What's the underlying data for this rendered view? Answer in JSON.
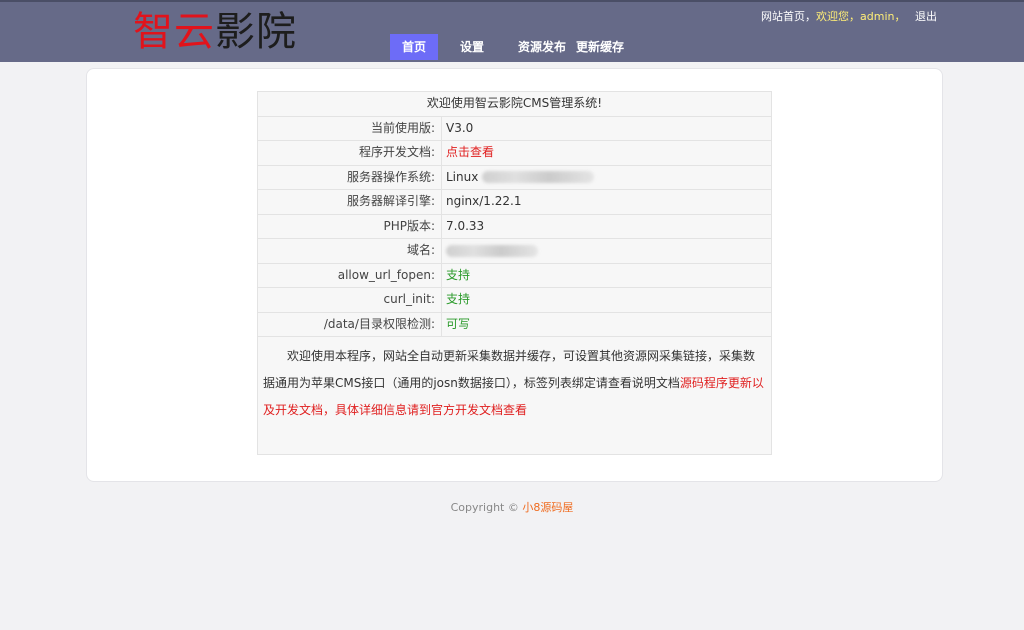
{
  "header": {
    "logo_part1": "智云",
    "logo_part2": "影院",
    "nav": [
      {
        "label": "首页"
      },
      {
        "label": "设置"
      },
      {
        "label": "资源发布"
      },
      {
        "label": "更新缓存"
      }
    ],
    "links": {
      "site_home": "网站首页",
      "separator1": "，",
      "welcome": "欢迎您，admin，",
      "logout": "退出"
    }
  },
  "info": {
    "title": "欢迎使用智云影院CMS管理系统!",
    "rows": [
      {
        "key": "当前使用版:",
        "value": "V3.0"
      },
      {
        "key": "程序开发文档:",
        "value": "点击查看"
      },
      {
        "key": "服务器操作系统:",
        "value": "Linux"
      },
      {
        "key": "服务器解译引擎:",
        "value": "nginx/1.22.1"
      },
      {
        "key": "PHP版本:",
        "value": "7.0.33"
      },
      {
        "key": "域名:",
        "value": ""
      },
      {
        "key": "allow_url_fopen:",
        "value": "支持"
      },
      {
        "key": "curl_init:",
        "value": "支持"
      },
      {
        "key": "/data/目录权限检测:",
        "value": "可写"
      }
    ],
    "description": {
      "normal": "欢迎使用本程序，网站全自动更新采集数据并缓存，可设置其他资源网采集链接，采集数据通用为苹果CMS接口（通用的josn数据接口），标签列表绑定请查看说明文档",
      "highlight": "源码程序更新以及开发文档，具体详细信息请到官方开发文档查看"
    }
  },
  "footer": {
    "copyright": "Copyright © ",
    "brand": "小8源码屋"
  },
  "colors": {
    "header_bg": "#666a88",
    "nav_active": "#6d6cf7",
    "logo_red": "#e1131b",
    "warning_red": "#e02020",
    "ok_green": "#2a9a2a",
    "footer_brand": "#ef6b1f"
  }
}
